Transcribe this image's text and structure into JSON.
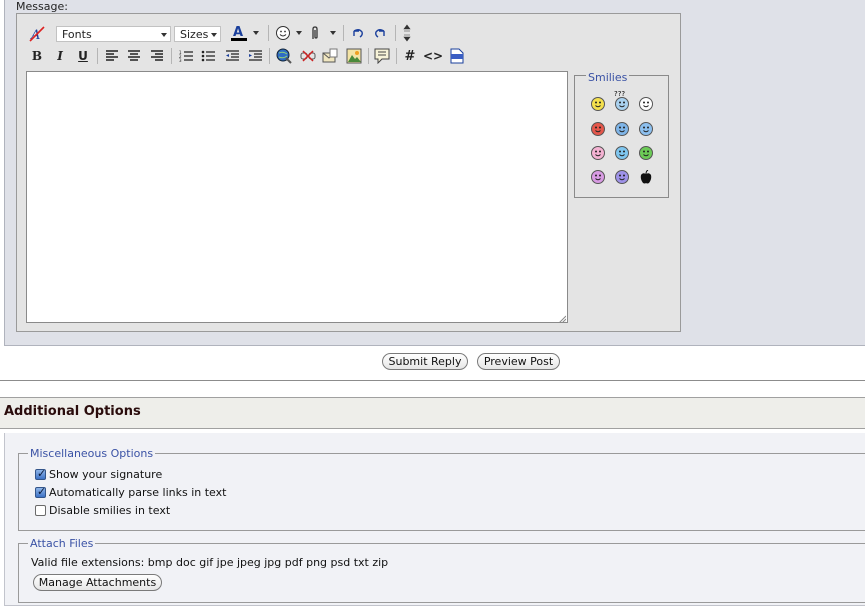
{
  "message_label": "Message:",
  "toolbar": {
    "font_select": "Fonts",
    "size_select": "Sizes",
    "buttons": {
      "bold": "B",
      "italic": "I",
      "underline": "U",
      "hash": "#",
      "code": "<>"
    }
  },
  "smilies": {
    "legend": "Smilies",
    "items": [
      {
        "name": "smile",
        "color": "#f4e04d"
      },
      {
        "name": "confused",
        "color": "#a9d1ef",
        "label": "???"
      },
      {
        "name": "eek",
        "color": "#ffffff"
      },
      {
        "name": "mad",
        "color": "#e4574b"
      },
      {
        "name": "rolleyes",
        "color": "#7fb5e8"
      },
      {
        "name": "cool",
        "color": "#8dc0ef"
      },
      {
        "name": "tongue",
        "color": "#f4b2d2"
      },
      {
        "name": "wink",
        "color": "#7fc6ef"
      },
      {
        "name": "biggrin",
        "color": "#6cca56"
      },
      {
        "name": "redface",
        "color": "#d89be3"
      },
      {
        "name": "frown",
        "color": "#9e92e8"
      },
      {
        "name": "apple",
        "color": "#111111"
      }
    ]
  },
  "actions": {
    "submit": "Submit Reply",
    "preview": "Preview Post"
  },
  "additional": {
    "title": "Additional Options",
    "misc": {
      "legend": "Miscellaneous Options",
      "options": [
        {
          "label": "Show your signature",
          "checked": true
        },
        {
          "label": "Automatically parse links in text",
          "checked": true
        },
        {
          "label": "Disable smilies in text",
          "checked": false
        }
      ]
    },
    "attach": {
      "legend": "Attach Files",
      "extensions": "Valid file extensions: bmp doc gif jpe jpeg jpg pdf png psd txt zip",
      "manage_button": "Manage Attachments"
    }
  }
}
